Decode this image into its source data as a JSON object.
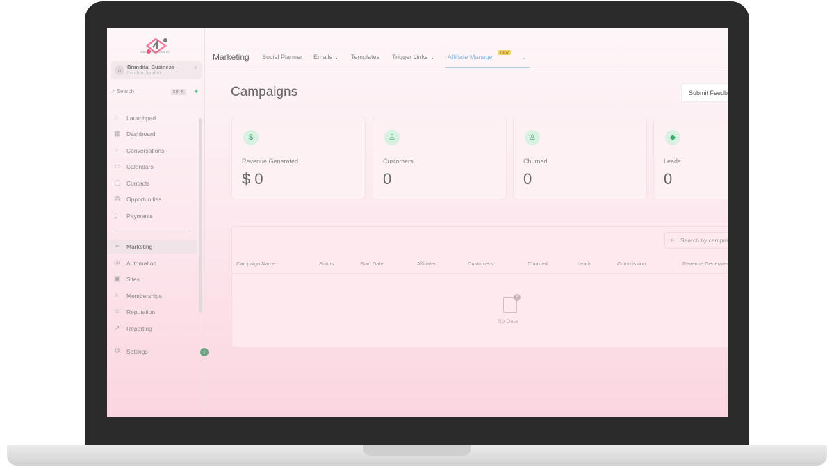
{
  "logo": {
    "text": "CASE PROCESS.IO"
  },
  "account": {
    "name": "Brandital Business",
    "location": "London, london"
  },
  "search": {
    "placeholder": "Search",
    "shortcut": "ctrl K"
  },
  "sidebar": {
    "items": [
      {
        "label": "Launchpad",
        "icon": "rocket-icon"
      },
      {
        "label": "Dashboard",
        "icon": "grid-icon"
      },
      {
        "label": "Conversations",
        "icon": "chat-icon"
      },
      {
        "label": "Calendars",
        "icon": "calendar-icon"
      },
      {
        "label": "Contacts",
        "icon": "contacts-icon"
      },
      {
        "label": "Opportunities",
        "icon": "funnel-icon"
      },
      {
        "label": "Payments",
        "icon": "payments-icon"
      },
      {
        "label": "Marketing",
        "icon": "send-icon"
      },
      {
        "label": "Automation",
        "icon": "automation-icon"
      },
      {
        "label": "Sites",
        "icon": "sites-icon"
      },
      {
        "label": "Memberships",
        "icon": "award-icon"
      },
      {
        "label": "Reputation",
        "icon": "star-icon"
      },
      {
        "label": "Reporting",
        "icon": "trend-icon"
      }
    ],
    "settings": "Settings"
  },
  "topnav": {
    "title": "Marketing",
    "tabs": [
      "Social Planner",
      "Emails",
      "Templates",
      "Trigger Links",
      "Affiliate Manager"
    ],
    "badge": "new"
  },
  "page": {
    "title": "Campaigns",
    "feedback": "Submit Feedback"
  },
  "cards": [
    {
      "label": "Revenue Generated",
      "value": "$ 0",
      "icon": "dollar-icon"
    },
    {
      "label": "Customers",
      "value": "0",
      "icon": "user-icon"
    },
    {
      "label": "Churned",
      "value": "0",
      "icon": "user-plus-icon"
    },
    {
      "label": "Leads",
      "value": "0",
      "icon": "diamond-icon"
    }
  ],
  "table": {
    "search_placeholder": "Search by campaign",
    "columns": [
      "Campaign Name",
      "Status",
      "Start Date",
      "Affiliates",
      "Customers",
      "Churned",
      "Leads",
      "Commission",
      "Revenue Generated"
    ],
    "empty": "No Data"
  }
}
